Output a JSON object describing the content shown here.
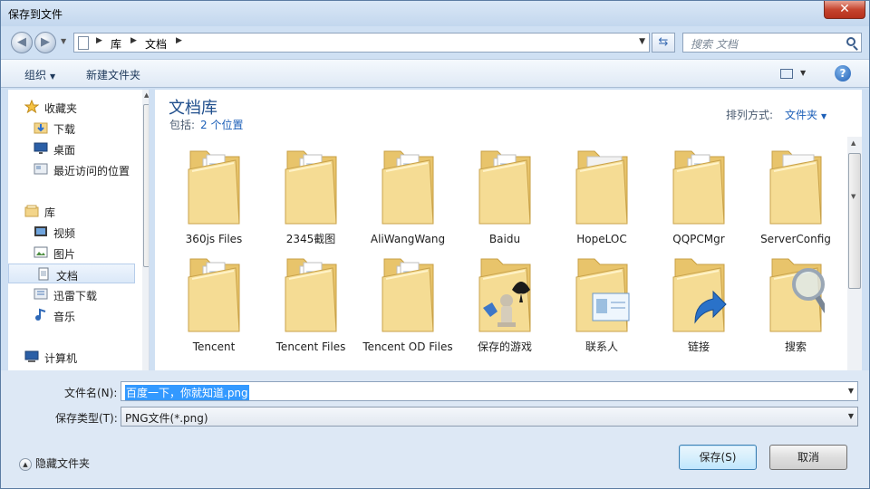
{
  "window": {
    "title": "保存到文件",
    "close_glyph": "✕"
  },
  "address": {
    "crumbs": [
      "库",
      "文档"
    ],
    "search_placeholder": "搜索 文档"
  },
  "toolbar": {
    "organize_label": "组织",
    "new_folder_label": "新建文件夹",
    "help_glyph": "?"
  },
  "nav": {
    "items": [
      {
        "label": "收藏夹",
        "icon": "star-icon",
        "selected": false
      },
      {
        "label": "下载",
        "icon": "downloads-folder-icon",
        "selected": false
      },
      {
        "label": "桌面",
        "icon": "desktop-icon",
        "selected": false
      },
      {
        "label": "最近访问的位置",
        "icon": "recent-places-icon",
        "selected": false
      },
      {
        "label": "库",
        "icon": "library-icon",
        "selected": false
      },
      {
        "label": "视频",
        "icon": "video-icon",
        "selected": false
      },
      {
        "label": "图片",
        "icon": "pictures-icon",
        "selected": false
      },
      {
        "label": "文档",
        "icon": "documents-icon",
        "selected": true
      },
      {
        "label": "迅雷下载",
        "icon": "thunder-download-icon",
        "selected": false
      },
      {
        "label": "音乐",
        "icon": "music-icon",
        "selected": false
      },
      {
        "label": "计算机",
        "icon": "computer-icon",
        "selected": false
      }
    ]
  },
  "main": {
    "library_title": "文档库",
    "includes_label": "包括:",
    "locations_link": "2 个位置",
    "sort_label": "排列方式:",
    "sort_value": "文件夹",
    "folders": [
      {
        "name": "360js Files",
        "overlay": "documents"
      },
      {
        "name": "2345截图",
        "overlay": "documents"
      },
      {
        "name": "AliWangWang",
        "overlay": "documents"
      },
      {
        "name": "Baidu",
        "overlay": "documents"
      },
      {
        "name": "HopeLOC",
        "overlay": "gear"
      },
      {
        "name": "QQPCMgr",
        "overlay": "documents"
      },
      {
        "name": "ServerConfig",
        "overlay": "blank"
      },
      {
        "name": "Tencent",
        "overlay": "documents"
      },
      {
        "name": "Tencent Files",
        "overlay": "documents"
      },
      {
        "name": "Tencent OD Files",
        "overlay": "documents"
      },
      {
        "name": "保存的游戏",
        "overlay": "games"
      },
      {
        "name": "联系人",
        "overlay": "contact"
      },
      {
        "name": "链接",
        "overlay": "link"
      },
      {
        "name": "搜索",
        "overlay": "search"
      }
    ]
  },
  "form": {
    "filename_label": "文件名(N):",
    "filename_value": "百度一下，你就知道.png",
    "filetype_label": "保存类型(T):",
    "filetype_value": "PNG文件(*.png)"
  },
  "footer": {
    "hide_folders_label": "隐藏文件夹",
    "save_label": "保存(S)",
    "cancel_label": "取消"
  },
  "colors": {
    "accent_link": "#1c5fb8",
    "selection": "#3399ff",
    "folder": "#f3d58a"
  }
}
